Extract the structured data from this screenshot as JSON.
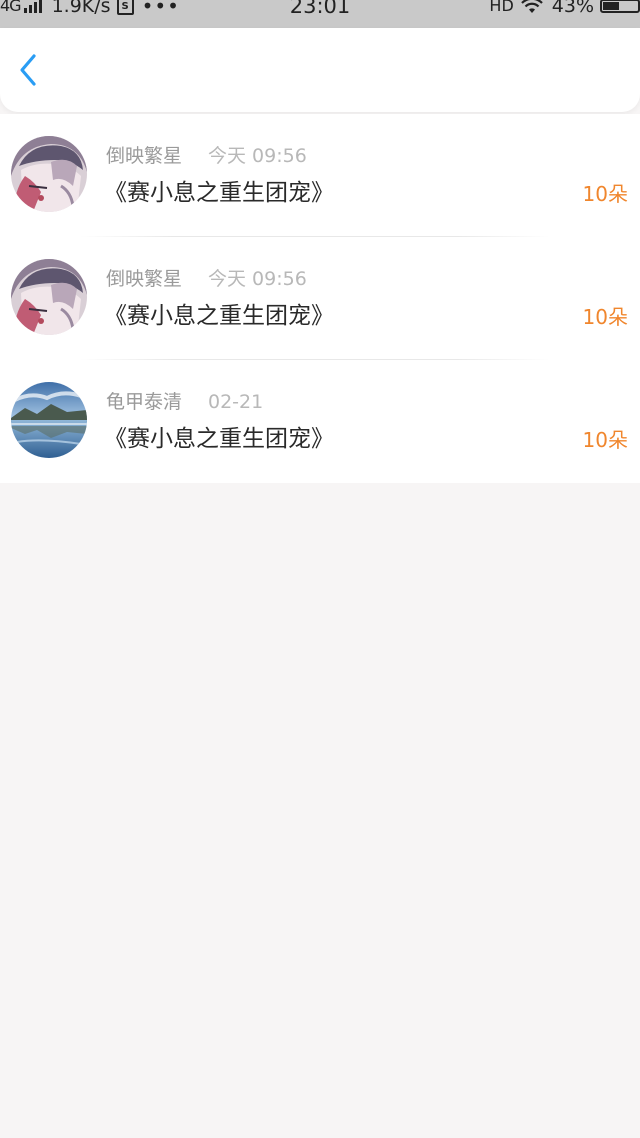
{
  "status_bar": {
    "network": "4G",
    "speed": "1.9K/s",
    "s_icon": "S",
    "dots": "•••",
    "time": "23:01",
    "hd": "HD",
    "battery": "43%"
  },
  "nav": {
    "back_icon": "chevron-left-icon",
    "accent_color": "#2a9df4"
  },
  "records": [
    {
      "user": "倒映繁星",
      "time": "今天 09:56",
      "title": "《赛小息之重生团宠》",
      "amount": "10朵",
      "avatar": "anime-character-avatar"
    },
    {
      "user": "倒映繁星",
      "time": "今天 09:56",
      "title": "《赛小息之重生团宠》",
      "amount": "10朵",
      "avatar": "anime-character-avatar"
    },
    {
      "user": "龟甲泰清",
      "time": "02-21",
      "title": "《赛小息之重生团宠》",
      "amount": "10朵",
      "avatar": "landscape-lake-avatar"
    }
  ],
  "colors": {
    "amount": "#f0862d",
    "background": "#f7f5f5"
  }
}
